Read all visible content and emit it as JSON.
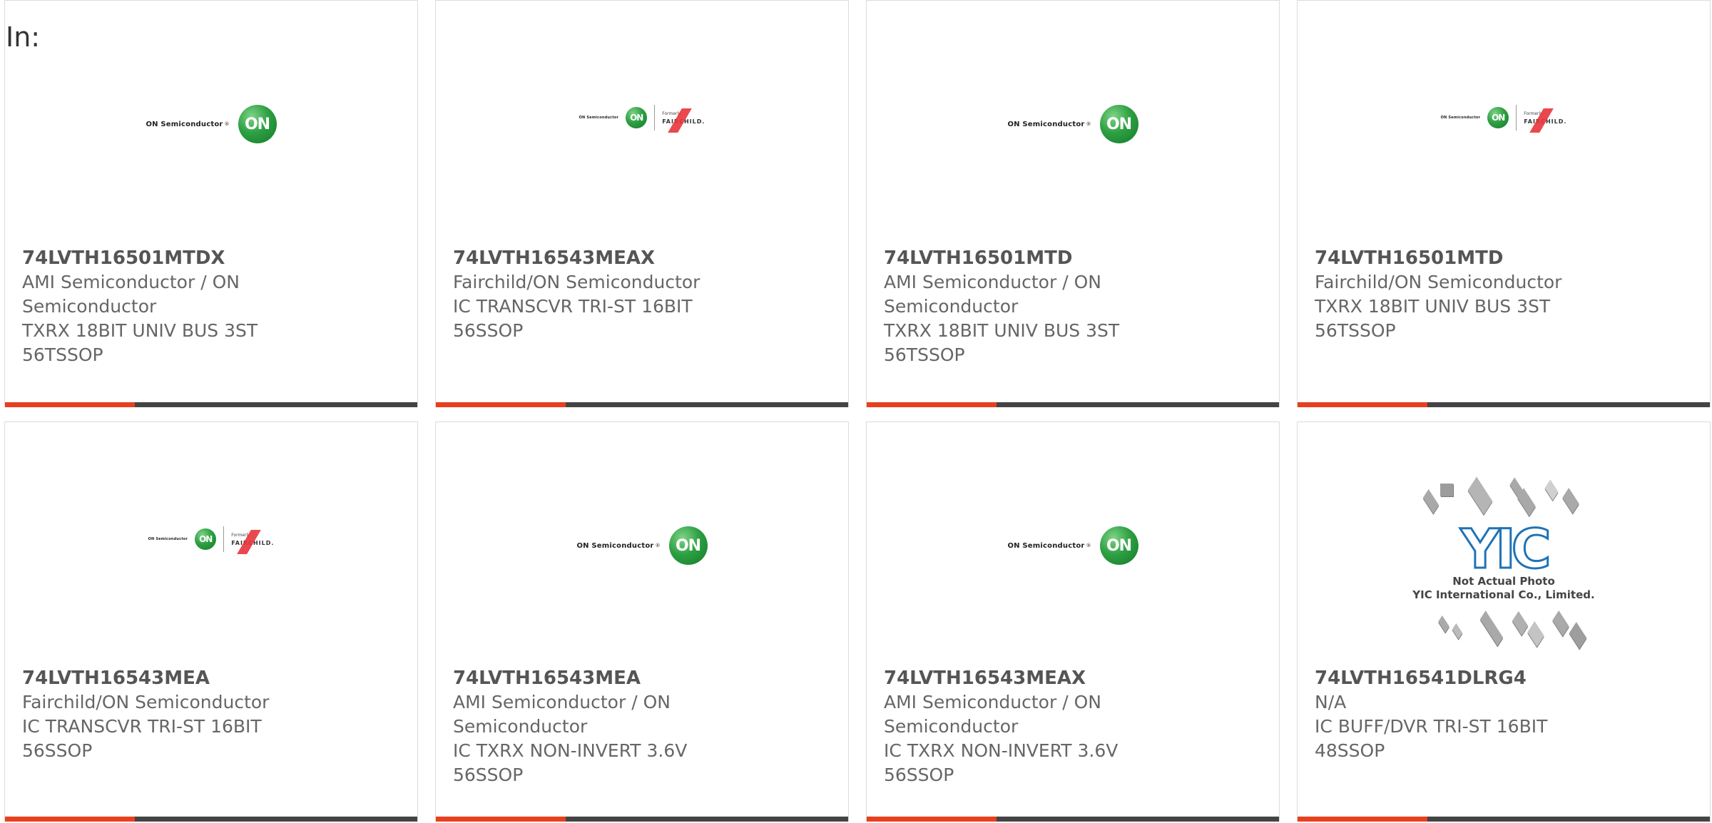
{
  "header": {
    "in_label": "In:"
  },
  "colors": {
    "accent_bar": "#e8401e",
    "dark_bar": "#444444",
    "on_green": "#2ea043",
    "fairchild_red": "#e8343a",
    "yic_blue": "#1e73b8"
  },
  "logos": {
    "on_semiconductor_text": "ON Semiconductor",
    "on_badge": "ON",
    "fairchild_formerly": "Formerly",
    "fairchild_name": "FAIRCHILD.",
    "yic_mark": "YIC",
    "yic_note_line1": "Not Actual Photo",
    "yic_note_line2": "YIC International Co., Limited."
  },
  "products": [
    {
      "logo": "on-semiconductor-logo",
      "part_number": "74LVTH16501MTDX",
      "lines": [
        "AMI Semiconductor / ON",
        "Semiconductor",
        "TXRX 18BIT UNIV BUS 3ST",
        "56TSSOP"
      ]
    },
    {
      "logo": "fairchild-on-logo",
      "part_number": "74LVTH16543MEAX",
      "lines": [
        "Fairchild/ON Semiconductor",
        "IC TRANSCVR TRI-ST 16BIT",
        "56SSOP"
      ]
    },
    {
      "logo": "on-semiconductor-logo",
      "part_number": "74LVTH16501MTD",
      "lines": [
        "AMI Semiconductor / ON",
        "Semiconductor",
        "TXRX 18BIT UNIV BUS 3ST",
        "56TSSOP"
      ]
    },
    {
      "logo": "fairchild-on-logo",
      "part_number": "74LVTH16501MTD",
      "lines": [
        "Fairchild/ON Semiconductor",
        "TXRX 18BIT UNIV BUS 3ST",
        "56TSSOP"
      ]
    },
    {
      "logo": "fairchild-on-logo",
      "part_number": "74LVTH16543MEA",
      "lines": [
        "Fairchild/ON Semiconductor",
        "IC TRANSCVR TRI-ST 16BIT",
        "56SSOP"
      ]
    },
    {
      "logo": "on-semiconductor-logo",
      "part_number": "74LVTH16543MEA",
      "lines": [
        "AMI Semiconductor / ON",
        "Semiconductor",
        "IC TXRX NON-INVERT 3.6V",
        "56SSOP"
      ]
    },
    {
      "logo": "on-semiconductor-logo",
      "part_number": "74LVTH16543MEAX",
      "lines": [
        "AMI Semiconductor / ON",
        "Semiconductor",
        "IC TXRX NON-INVERT 3.6V",
        "56SSOP"
      ]
    },
    {
      "logo": "yic-not-actual-photo",
      "part_number": "74LVTH16541DLRG4",
      "lines": [
        "N/A",
        "IC BUFF/DVR TRI-ST 16BIT",
        "48SSOP"
      ]
    }
  ]
}
